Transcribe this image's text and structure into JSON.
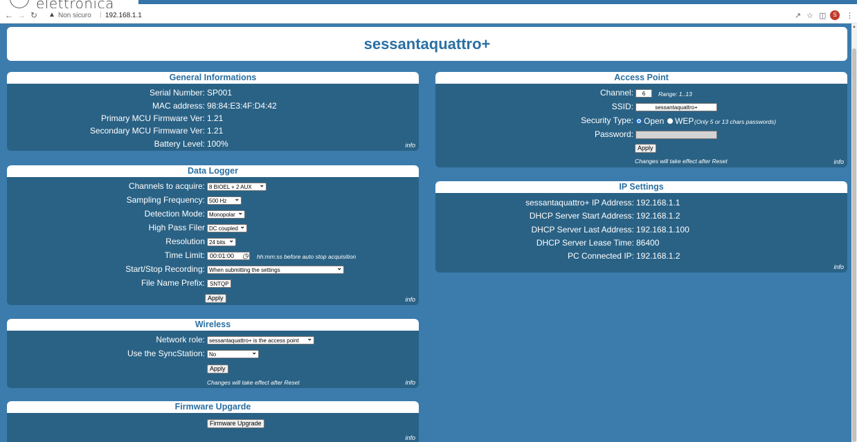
{
  "browser": {
    "logo_text": "elettronica",
    "security_label": "Non sicuro",
    "url": "192.168.1.1",
    "profile_initial": "S"
  },
  "page_title": "sessantaquattro+",
  "general": {
    "title": "General Informations",
    "info": "info",
    "rows": [
      {
        "label": "Serial Number:",
        "value": "SP001"
      },
      {
        "label": "MAC address:",
        "value": "98:84:E3:4F:D4:42"
      },
      {
        "label": "Primary MCU Firmware Ver:",
        "value": "1.21"
      },
      {
        "label": "Secondary MCU Firmware Ver:",
        "value": "1.21"
      },
      {
        "label": "Battery Level:",
        "value": "100%"
      }
    ]
  },
  "logger": {
    "title": "Data Logger",
    "info": "info",
    "channels_label": "Channels to acquire:",
    "channels_value": "8 BIOEL + 2 AUX",
    "sampling_label": "Sampling Frequency:",
    "sampling_value": "500 Hz",
    "detection_label": "Detection Mode:",
    "detection_value": "Monopolar",
    "highpass_label": "High Pass Filer",
    "highpass_value": "DC coupled",
    "resolution_label": "Resolution",
    "resolution_value": "24 bits",
    "timelimit_label": "Time Limit:",
    "timelimit_value": "00:01:00",
    "timelimit_note": "hh:mm:ss before auto stop acquisition",
    "startstop_label": "Start/Stop Recording:",
    "startstop_value": "When submitting the settings",
    "prefix_label": "File Name Prefix:",
    "prefix_value": "SNTQP",
    "apply": "Apply"
  },
  "wireless": {
    "title": "Wireless",
    "info": "info",
    "role_label": "Network role:",
    "role_value": "sessantaquattro+ is the access point",
    "sync_label": "Use the SyncStation:",
    "sync_value": "No",
    "apply": "Apply",
    "note": "Changes will take effect after Reset"
  },
  "firmware": {
    "title": "Firmware Upgarde",
    "button": "Firmware Upgrade",
    "info": "info"
  },
  "access_point": {
    "title": "Access Point",
    "info": "info",
    "channel_label": "Channel:",
    "channel_value": "6",
    "channel_range": "Range: 1..13",
    "ssid_label": "SSID:",
    "ssid_value": "sessantaquattro+",
    "security_label": "Security Type:",
    "security_open": "Open",
    "security_wep": "WEP",
    "security_note": "(Only 5 or 13 chars passwords)",
    "password_label": "Password:",
    "password_value": "",
    "apply": "Apply",
    "note": "Changes will take effect after Reset"
  },
  "ip": {
    "title": "IP Settings",
    "info": "info",
    "rows": [
      {
        "label": "sessantaquattro+ IP Address:",
        "value": "192.168.1.1"
      },
      {
        "label": "DHCP Server Start Address:",
        "value": "192.168.1.2"
      },
      {
        "label": "DHCP Server Last Address:",
        "value": "192.168.1.100"
      },
      {
        "label": "DHCP Server Lease Time:",
        "value": "86400"
      },
      {
        "label": "PC Connected IP:",
        "value": "192.168.1.2"
      }
    ]
  }
}
